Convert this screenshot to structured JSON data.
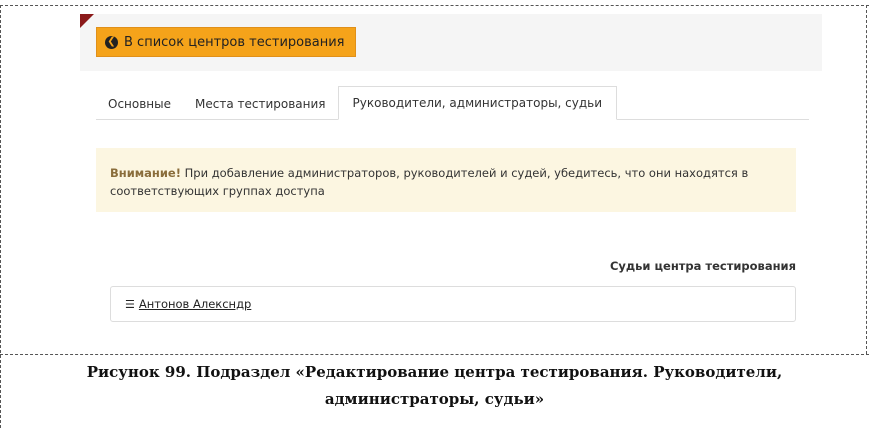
{
  "back_button": {
    "label": "В список центров тестирования",
    "icon": "arrow-left-circle-icon"
  },
  "tabs": [
    {
      "label": "Основные",
      "active": false
    },
    {
      "label": "Места тестирования",
      "active": false
    },
    {
      "label": "Руководители, администраторы, судьи",
      "active": true
    }
  ],
  "alert": {
    "strong": "Внимание!",
    "text": " При добавление администраторов, руководителей и судей, убедитесь, что они находятся в соответствующих группах доступа"
  },
  "judges": {
    "title": "Судьи центра тестирования",
    "items": [
      {
        "name": "Антонов Алексндр",
        "icon": "list-icon"
      }
    ]
  },
  "caption": {
    "line1": "Рисунок 99. Подраздел «Редактирование центра тестирования. Руководители,",
    "line2": "администраторы, судьи»"
  },
  "colors": {
    "accent": "#f5a31a",
    "alert_bg": "#fcf6e1",
    "corner": "#8b1a1a"
  }
}
